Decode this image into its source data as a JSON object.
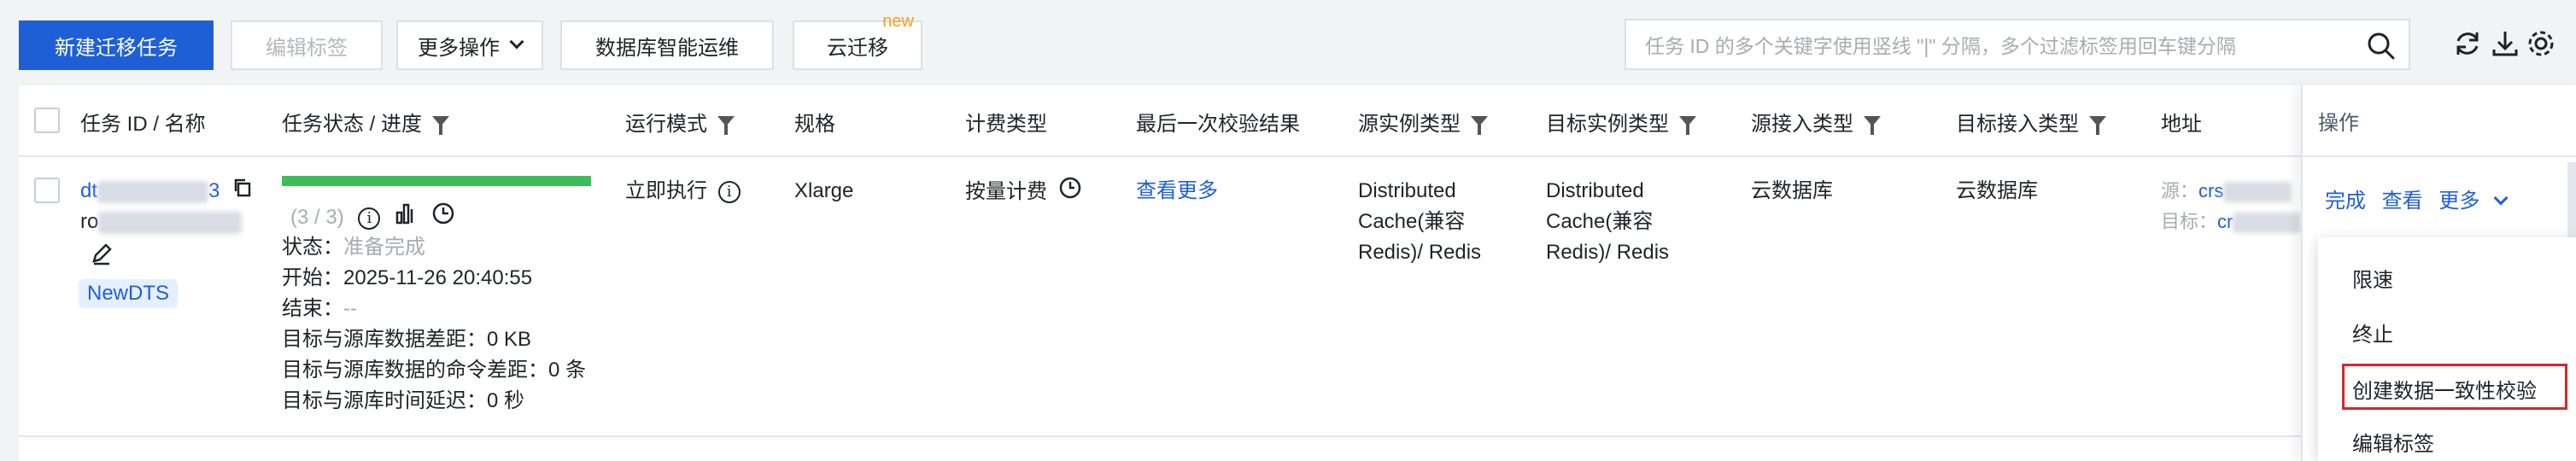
{
  "toolbar": {
    "new_task": "新建迁移任务",
    "edit_tag": "编辑标签",
    "more_actions": "更多操作",
    "db_ops": "数据库智能运维",
    "cloud_migrate": "云迁移",
    "new_badge": "new",
    "search_placeholder": "任务 ID 的多个关键字使用竖线 \"|\" 分隔，多个过滤标签用回车键分隔"
  },
  "columns": {
    "task": "任务 ID / 名称",
    "status": "任务状态 / 进度",
    "mode": "运行模式",
    "spec": "规格",
    "billing": "计费类型",
    "last_check": "最后一次校验结果",
    "src_type": "源实例类型",
    "dst_type": "目标实例类型",
    "src_access": "源接入类型",
    "dst_access": "目标接入类型",
    "address": "地址",
    "ops": "操作"
  },
  "row": {
    "task_id_prefix": "dt",
    "task_id_suffix": "3",
    "task_name_prefix": "ro",
    "tag": "NewDTS",
    "progress_count": "(3 / 3)",
    "progress_pct": 100,
    "status_label": "状态：",
    "status_value": "准备完成",
    "start_label": "开始：",
    "start_value": "2025-11-26 20:40:55",
    "end_label": "结束：",
    "end_value": "--",
    "data_gap_label": "目标与源库数据差距：",
    "data_gap_value": "0 KB",
    "cmd_gap_label": "目标与源库数据的命令差距：",
    "cmd_gap_value": "0 条",
    "delay_label": "目标与源库时间延迟：",
    "delay_value": "0 秒",
    "mode": "立即执行",
    "spec": "Xlarge",
    "billing": "按量计费",
    "last_check": "查看更多",
    "src_type_line1": "Distributed",
    "src_type_line2": "Cache(兼容",
    "src_type_line3": "Redis)/ Redis",
    "dst_type_line1": "Distributed",
    "dst_type_line2": "Cache(兼容",
    "dst_type_line3": "Redis)/ Redis",
    "src_access": "云数据库",
    "dst_access": "云数据库",
    "addr_src_label": "源：",
    "addr_src_value": "crs",
    "addr_dst_label": "目标：",
    "addr_dst_value": "cr"
  },
  "ops": {
    "complete": "完成",
    "view": "查看",
    "more": "更多"
  },
  "dropdown": {
    "items": [
      "限速",
      "终止",
      "创建数据一致性校验",
      "编辑标签"
    ]
  },
  "colors": {
    "primary": "#1f5fd6",
    "progress": "#3dbc5a",
    "highlight": "#d9262d"
  }
}
